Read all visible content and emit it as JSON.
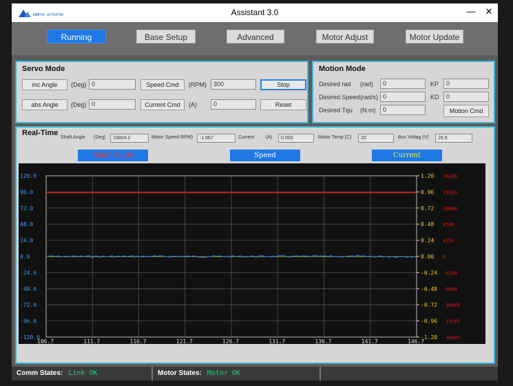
{
  "window": {
    "title": "Assistant 3.0",
    "brand": "INNFOS",
    "min_glyph": "—",
    "close_glyph": "✕"
  },
  "nav": {
    "running": "Running",
    "base_setup": "Base Setup",
    "advanced": "Advanced",
    "motor_adjust": "Motor Adjust",
    "motor_update": "Motor Update",
    "active": "Running"
  },
  "servo": {
    "title": "Servo Mode",
    "inc_angle_btn": "inc Angle",
    "inc_unit": "(Deg)",
    "inc_value": "0",
    "abs_angle_btn": "abs Angle",
    "abs_unit": "(Deg)",
    "abs_value": "0",
    "speed_cmd_btn": "Speed Cmd",
    "speed_unit": "(RPM)",
    "speed_value": "300",
    "current_cmd_btn": "Current Cmd",
    "current_unit": "(A)",
    "current_value": "0",
    "stop_btn": "Stop",
    "reset_btn": "Reset"
  },
  "motion": {
    "title": "Motion Mode",
    "desired_rad_label": "Desired rad",
    "desired_rad_unit": "(rad)",
    "desired_rad_value": "0",
    "desired_speed_label": "Desired Speed",
    "desired_speed_unit": "(rad/s)",
    "desired_speed_value": "0",
    "desired_tqu_label": "Desired Tqu",
    "desired_tqu_unit": "(N.m)",
    "desired_tqu_value": "0",
    "kp_label": "KP",
    "kp_value": "0",
    "kd_label": "KD",
    "kd_value": "0",
    "motion_cmd_btn": "Motion Cmd"
  },
  "realtime": {
    "title": "Real-Time",
    "shaft_angle_label": "Shaft Angle",
    "shaft_angle_unit": "(Deg)",
    "shaft_angle_value": "16804.2",
    "motor_speed_label": "Motor Speed RPM)",
    "motor_speed_value": "-1.567",
    "current_label": "Current",
    "current_unit": "(A)",
    "current_value": "0.003",
    "motor_temp_label": "Motor Temp (C)",
    "motor_temp_value": "20",
    "bus_voltage_label": "Bus Voltag (V)",
    "bus_voltage_value": "26.9",
    "legend_shaft": "Shaft Angle",
    "legend_speed": "Speed",
    "legend_current": "Current"
  },
  "colors": {
    "shaft": "#e01818",
    "speed": "#1e78e6",
    "current": "#e8e820",
    "left_axis": "#3a9cff",
    "right_axis2": "#e01818"
  },
  "chart_data": {
    "type": "line",
    "x_ticks": [
      "106.7",
      "111.7",
      "116.7",
      "121.7",
      "126.7",
      "131.7",
      "136.7",
      "141.7",
      "146.7"
    ],
    "xlim": [
      106.7,
      146.7
    ],
    "left_axis_ticks": [
      "120.0",
      "96.0",
      "72.0",
      "48.0",
      "24.0",
      "0.0",
      "-24.0",
      "-48.0",
      "-72.0",
      "-96.0",
      "-120.0"
    ],
    "left_ylim": [
      -120,
      120
    ],
    "right_axis_ticks": [
      "1.20",
      "0.96",
      "0.72",
      "0.48",
      "0.24",
      "0.00",
      "-0.24",
      "-0.48",
      "-0.72",
      "-0.96",
      "-1.20"
    ],
    "right_ylim": [
      -1.2,
      1.2
    ],
    "right_axis2_ticks": [
      "36445",
      "19165",
      "10080",
      "8500",
      "4250",
      "0",
      "-4250",
      "-8500",
      "-10080",
      "-19165",
      "-36445"
    ],
    "grid": true,
    "series": [
      {
        "name": "Shaft Angle",
        "values": [
          95.0,
          95.0
        ]
      },
      {
        "name": "Speed",
        "values": [
          0.0,
          0.0
        ]
      },
      {
        "name": "Current",
        "values": [
          0.0,
          0.0
        ]
      }
    ]
  },
  "status": {
    "comm_label": "Comm States:",
    "comm_value": "Link OK",
    "motor_label": "Motor States:",
    "motor_value": "Motor OK"
  }
}
